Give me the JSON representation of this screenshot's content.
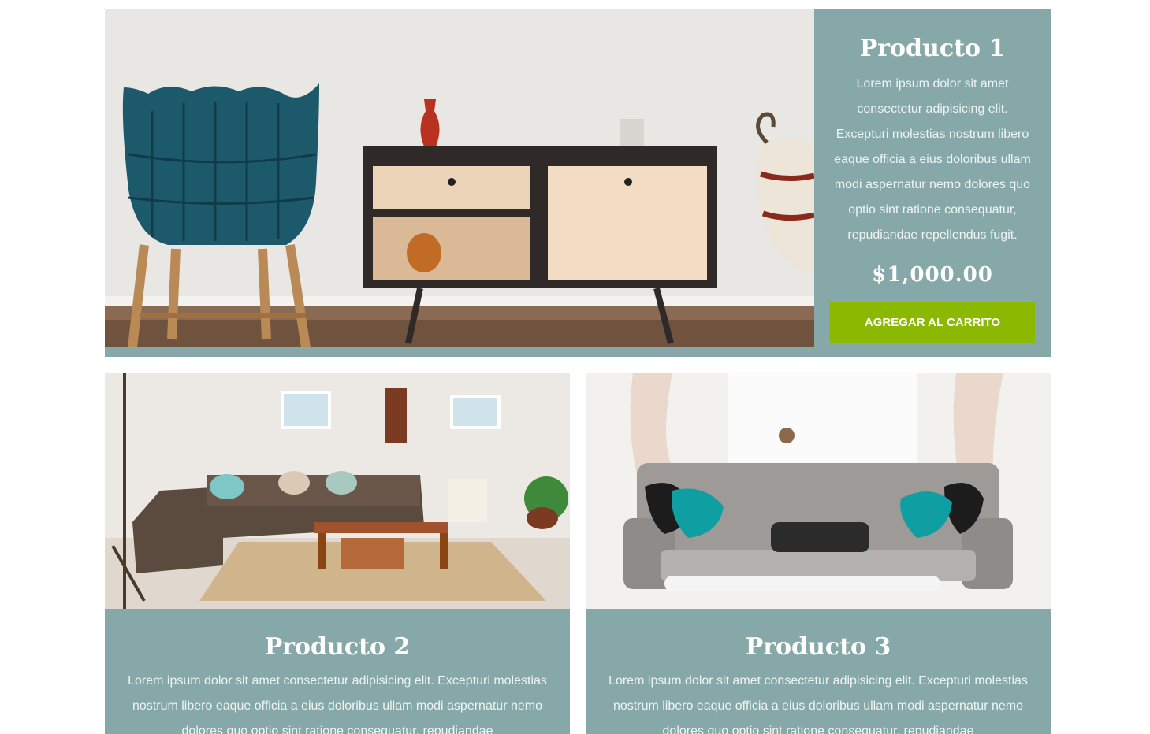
{
  "products": [
    {
      "title": "Producto 1",
      "description": "Lorem ipsum dolor sit amet consectetur adipisicing elit. Excepturi molestias nostrum libero eaque officia a eius doloribus ullam modi aspernatur nemo dolores quo optio sint ratione consequatur, repudiandae repellendus fugit.",
      "price": "$1,000.00",
      "button_label": "AGREGAR AL CARRITO",
      "image": "sideboard-with-teal-chair"
    },
    {
      "title": "Producto 2",
      "description": "Lorem ipsum dolor sit amet consectetur adipisicing elit. Excepturi molestias nostrum libero eaque officia a eius doloribus ullam modi aspernatur nemo dolores quo optio sint ratione consequatur, repudiandae",
      "image": "living-room-brown-sectional"
    },
    {
      "title": "Producto 3",
      "description": "Lorem ipsum dolor sit amet consectetur adipisicing elit. Excepturi molestias nostrum libero eaque officia a eius doloribus ullam modi aspernatur nemo dolores quo optio sint ratione consequatur, repudiandae",
      "image": "grey-sofa-teal-cushions"
    }
  ],
  "colors": {
    "card_bg": "#86a8a8",
    "button_bg": "#8bb800",
    "text": "#ffffff"
  }
}
